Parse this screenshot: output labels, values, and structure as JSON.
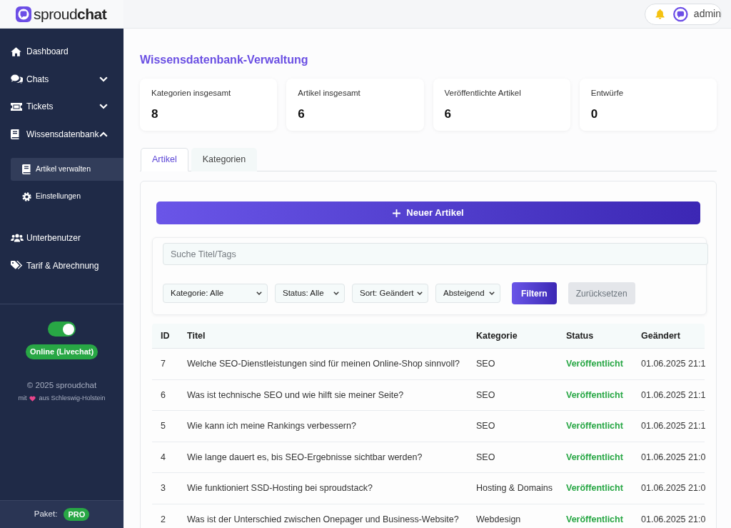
{
  "brand": {
    "name": "sproud**chat**"
  },
  "header": {
    "user": "admin"
  },
  "sidebar": {
    "items": [
      {
        "label": "Dashboard",
        "kind": "link",
        "selected": false
      },
      {
        "label": "Chats",
        "kind": "group",
        "expanded": false,
        "selected": false
      },
      {
        "label": "Tickets",
        "kind": "group",
        "expanded": false,
        "selected": false
      },
      {
        "label": "Wissensdatenbank",
        "kind": "group",
        "expanded": true,
        "selected": false,
        "children": [
          {
            "label": "Artikel verwalten",
            "selected": true
          },
          {
            "label": "Einstellungen",
            "selected": false
          }
        ]
      },
      {
        "label": "Unterbenutzer",
        "kind": "link",
        "selected": false
      },
      {
        "label": "Tarif & Abrechnung",
        "kind": "link",
        "selected": false
      }
    ],
    "livechat": {
      "on": true,
      "label": "Online (Livechat)"
    },
    "copyright": "© 2025 sproudchat",
    "credit": {
      "before": "mit",
      "after": "aus Schleswig-Holstein"
    },
    "plan": {
      "label": "Paket:",
      "badge": "PRO"
    }
  },
  "page": {
    "title": "Wissensdatenbank-Verwaltung"
  },
  "stats": [
    {
      "label": "Kategorien insgesamt",
      "value": "8"
    },
    {
      "label": "Artikel insgesamt",
      "value": "6"
    },
    {
      "label": "Veröffentlichte Artikel",
      "value": "6"
    },
    {
      "label": "Entwürfe",
      "value": "0"
    }
  ],
  "tabs": [
    {
      "label": "Artikel",
      "selected": true
    },
    {
      "label": "Kategorien",
      "selected": false
    }
  ],
  "new_button": {
    "label": "Neuer Artikel"
  },
  "filters": {
    "search": {
      "placeholder": "Suche Titel/Tags"
    },
    "selects": [
      "Kategorie: Alle",
      "Status: Alle",
      "Sort: Geändert",
      "Absteigend"
    ],
    "buttons": [
      {
        "label": "Filtern",
        "kind": "primary"
      },
      {
        "label": "Zurücksetzen",
        "kind": "secondary"
      }
    ]
  },
  "table": {
    "columns": [
      "ID",
      "Titel",
      "Kategorie",
      "Status",
      "Geändert"
    ],
    "rows": [
      {
        "id": "7",
        "title": "Welche SEO-Dienstleistungen sind für meinen Online-Shop sinnvoll?",
        "category": "SEO",
        "status": "Veröffentlicht",
        "changed": "01.06.2025 21:1"
      },
      {
        "id": "6",
        "title": "Was ist technische SEO und wie hilft sie meiner Seite?",
        "category": "SEO",
        "status": "Veröffentlicht",
        "changed": "01.06.2025 21:1"
      },
      {
        "id": "5",
        "title": "Wie kann ich meine Rankings verbessern?",
        "category": "SEO",
        "status": "Veröffentlicht",
        "changed": "01.06.2025 21:1"
      },
      {
        "id": "4",
        "title": "Wie lange dauert es, bis SEO-Ergebnisse sichtbar werden?",
        "category": "SEO",
        "status": "Veröffentlicht",
        "changed": "01.06.2025 21:0"
      },
      {
        "id": "3",
        "title": "Wie funktioniert SSD-Hosting bei sproudstack?",
        "category": "Hosting & Domains",
        "status": "Veröffentlicht",
        "changed": "01.06.2025 21:0"
      },
      {
        "id": "2",
        "title": "Was ist der Unterschied zwischen Onepager und Business-Website?",
        "category": "Webdesign",
        "status": "Veröffentlicht",
        "changed": "01.06.2025 21:0"
      }
    ]
  }
}
